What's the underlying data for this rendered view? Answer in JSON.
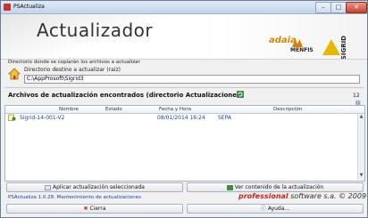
{
  "window": {
    "title": "PSActualiza",
    "min_glyph": "–",
    "max_glyph": "□",
    "close_glyph": "✕"
  },
  "header": {
    "title": "Actualizador",
    "logo_adaia": "adaia",
    "logo_menfis": "MENFIS",
    "logo_sigrid": "SIGRID"
  },
  "destination": {
    "group_label": "Directorio donde se copiarán los archivos a actualizar",
    "label": "Directorio destino a actualizar (raiz)",
    "value": "C:\\AppProsoft\\Sigrid3"
  },
  "files": {
    "title": "Archivos de actualización encontrados (directorio Actualizaciones)",
    "count": "12",
    "columns": [
      "Nombre",
      "Estado",
      "Fecha y Hora",
      "Descripción"
    ],
    "rows": [
      {
        "name": "Sigrid-14-001-V2",
        "state": "",
        "datetime": "08/01/2014 16:24",
        "description": "SEPA"
      }
    ]
  },
  "buttons": {
    "apply": "Aplicar actualización seleccionada",
    "view": "Ver contenido de la actualización",
    "close": "Cierra",
    "help": "Ayuda..."
  },
  "footer": {
    "version": "PSActualiza 1.0.28. Mantenimiento de actualizaciones",
    "brand_pro": "professional",
    "brand_soft": " software s.a.",
    "brand_year": " © 2009"
  },
  "colors": {
    "accent": "#1f3fa8",
    "brand_red": "#d21f1f"
  }
}
